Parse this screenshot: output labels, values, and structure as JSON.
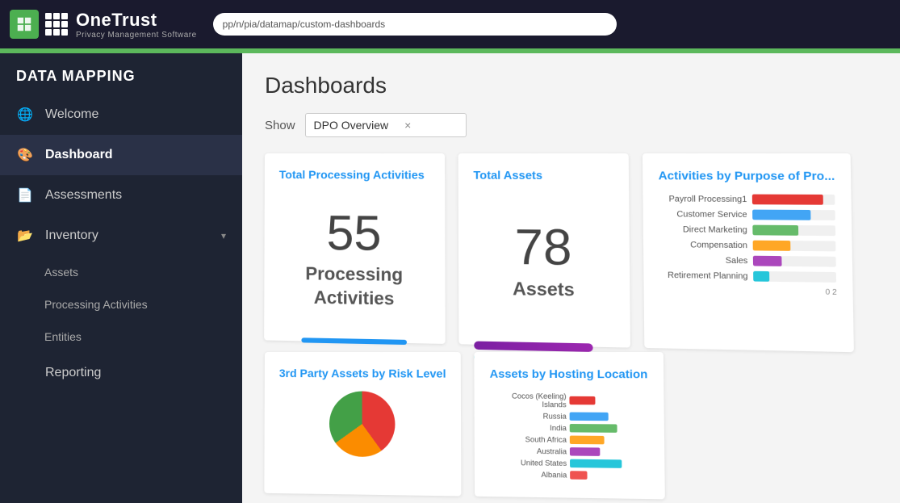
{
  "topbar": {
    "logo_main": "OneTrust",
    "logo_sub": "Privacy Management Software",
    "url": "pp/n/pia/datamap/custom-dashboards"
  },
  "sidebar": {
    "section_title": "DATA MAPPING",
    "items": [
      {
        "id": "welcome",
        "label": "Welcome",
        "icon": "globe",
        "active": false,
        "has_sub": false
      },
      {
        "id": "dashboard",
        "label": "Dashboard",
        "icon": "palette",
        "active": true,
        "has_sub": false
      },
      {
        "id": "assessments",
        "label": "Assessments",
        "icon": "document",
        "active": false,
        "has_sub": false
      },
      {
        "id": "inventory",
        "label": "Inventory",
        "icon": "folder",
        "active": false,
        "has_sub": true
      }
    ],
    "sub_items": [
      {
        "id": "assets",
        "label": "Assets"
      },
      {
        "id": "processing-activities",
        "label": "Processing Activities"
      },
      {
        "id": "entities",
        "label": "Entities"
      }
    ],
    "more_label": "Reporting"
  },
  "content": {
    "page_title": "Dashboards",
    "show_label": "Show",
    "show_value": "DPO Overview",
    "show_clear": "×"
  },
  "cards": {
    "total_processing": {
      "title": "Total Processing Activities",
      "number": "55",
      "label_line1": "Processing",
      "label_line2": "Activities"
    },
    "total_assets": {
      "title": "Total Assets",
      "number": "78",
      "label": "Assets"
    },
    "activities_by_purpose": {
      "title": "Activities by Purpose of Pro...",
      "rows": [
        {
          "label": "Payroll Processing1",
          "value": 85,
          "color": "#e53935"
        },
        {
          "label": "Customer Service",
          "value": 70,
          "color": "#42a5f5"
        },
        {
          "label": "Direct Marketing",
          "value": 55,
          "color": "#66bb6a"
        },
        {
          "label": "Compensation",
          "value": 45,
          "color": "#ffa726"
        },
        {
          "label": "Sales",
          "value": 35,
          "color": "#ab47bc"
        },
        {
          "label": "Retirement Planning",
          "value": 20,
          "color": "#26c6da"
        }
      ],
      "axis": "0    2"
    },
    "third_party_assets": {
      "title": "3rd Party Assets by Risk Level"
    },
    "assets_by_hosting": {
      "title": "Assets by Hosting Location",
      "rows": [
        {
          "label": "Cocos (Keeling) Islands",
          "value": 30,
          "color": "#e53935"
        },
        {
          "label": "Russia",
          "value": 45,
          "color": "#42a5f5"
        },
        {
          "label": "India",
          "value": 55,
          "color": "#66bb6a"
        },
        {
          "label": "South Africa",
          "value": 40,
          "color": "#ffa726"
        },
        {
          "label": "Australia",
          "value": 35,
          "color": "#ab47bc"
        },
        {
          "label": "United States",
          "value": 60,
          "color": "#26c6da"
        },
        {
          "label": "Albania",
          "value": 20,
          "color": "#ef5350"
        }
      ]
    }
  }
}
